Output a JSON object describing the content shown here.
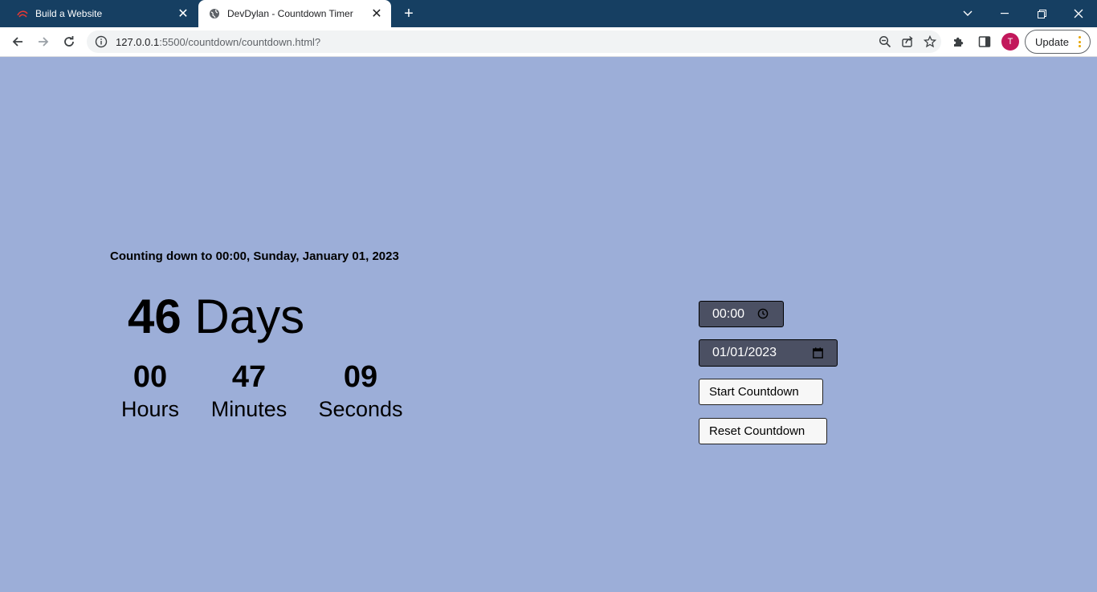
{
  "browser": {
    "tabs": [
      {
        "label": "Build a Website",
        "active": false,
        "favicon": "brand-logo-icon"
      },
      {
        "label": "DevDylan - Countdown Timer",
        "active": true,
        "favicon": "globe-icon"
      }
    ],
    "address": {
      "host": "127.0.0.1",
      "rest": ":5500/countdown/countdown.html?"
    },
    "avatar_letter": "T",
    "update_label": "Update"
  },
  "page": {
    "heading": "Counting down to 00:00, Sunday, January 01, 2023",
    "days": {
      "value": "46",
      "label": "Days"
    },
    "units": [
      {
        "value": "00",
        "label": "Hours"
      },
      {
        "value": "47",
        "label": "Minutes"
      },
      {
        "value": "09",
        "label": "Seconds"
      }
    ],
    "time_value": "00:00",
    "date_value": "01/01/2023",
    "start_label": "Start Countdown",
    "reset_label": "Reset Countdown"
  },
  "colors": {
    "page_bg": "#9caed8",
    "tabstrip_bg": "#163f62",
    "input_bg": "#4b5063",
    "avatar_bg": "#c2185b"
  }
}
